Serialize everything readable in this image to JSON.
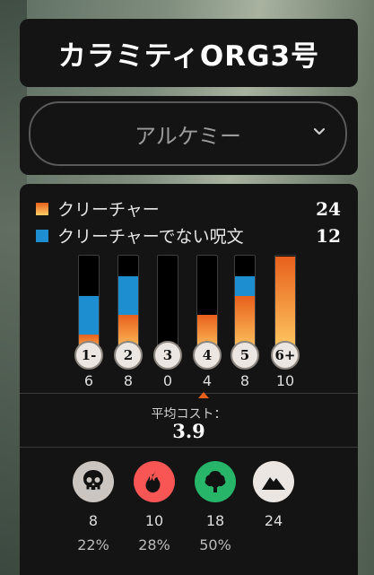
{
  "deck": {
    "name": "カラミティORG3号",
    "format": "アルケミー"
  },
  "legend": [
    {
      "label": "クリーチャー",
      "count": "24",
      "color": "#f0842c"
    },
    {
      "label": "クリーチャーでない呪文",
      "count": "12",
      "color": "#1d8fd1"
    }
  ],
  "curve": [
    {
      "cost": "1-",
      "count": "6",
      "creatures": 2,
      "noncreatures": 4
    },
    {
      "cost": "2",
      "count": "8",
      "creatures": 4,
      "noncreatures": 4
    },
    {
      "cost": "3",
      "count": "0",
      "creatures": 0,
      "noncreatures": 0
    },
    {
      "cost": "4",
      "count": "4",
      "creatures": 4,
      "noncreatures": 0
    },
    {
      "cost": "5",
      "count": "8",
      "creatures": 6,
      "noncreatures": 2
    },
    {
      "cost": "6+",
      "count": "10",
      "creatures": 10,
      "noncreatures": 0
    }
  ],
  "average": {
    "label": "平均コスト：",
    "value": "3.9"
  },
  "mana": [
    {
      "icon": "black-mana-skull-icon",
      "color": "#cac5c0",
      "count": "8",
      "percent": "22%"
    },
    {
      "icon": "red-mana-fire-icon",
      "color": "#f85555",
      "count": "10",
      "percent": "28%"
    },
    {
      "icon": "green-mana-tree-icon",
      "color": "#26b569",
      "count": "18",
      "percent": "50%"
    },
    {
      "icon": "colorless-land-icon",
      "color": "#ebe6e2",
      "count": "24",
      "percent": ""
    }
  ]
}
